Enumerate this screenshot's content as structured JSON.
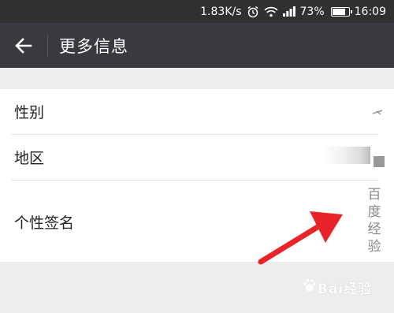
{
  "status_bar": {
    "speed": "1.83K/s",
    "battery_percent": "73%",
    "time": "16:09",
    "battery_level": 0.73
  },
  "title_bar": {
    "title": "更多信息",
    "back_icon": "arrow-left-icon"
  },
  "rows": [
    {
      "label": "性别",
      "value": ""
    },
    {
      "label": "地区",
      "value": ""
    },
    {
      "label": "个性签名",
      "value": "百度经验"
    }
  ],
  "watermark": {
    "text": "Bai经验"
  },
  "colors": {
    "status_bar": "#303030",
    "title_bar": "#393a3f",
    "background": "#ededed",
    "arrow": "#e8242a"
  }
}
